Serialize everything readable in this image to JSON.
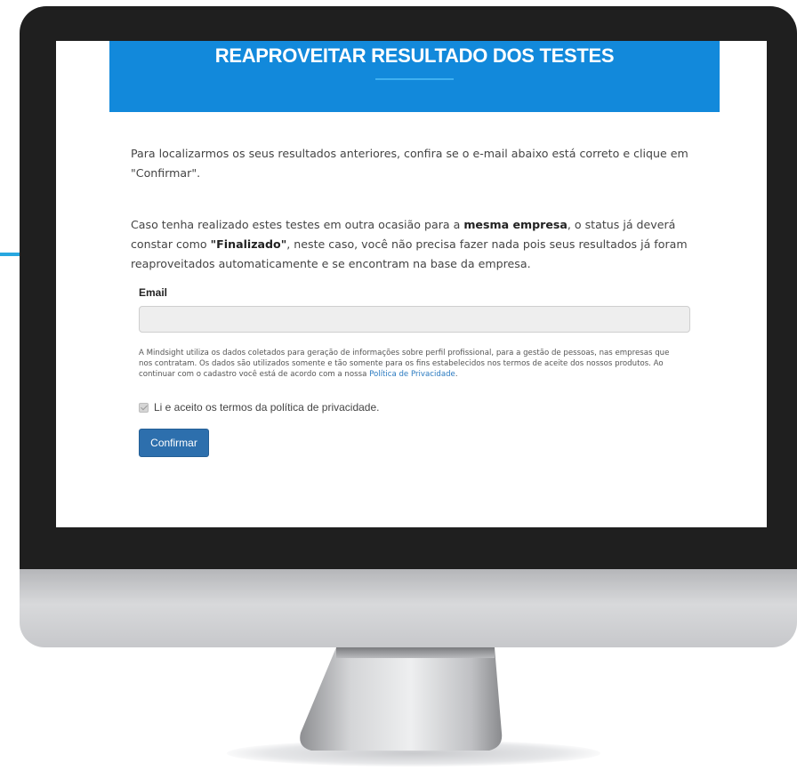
{
  "hero": {
    "title": "REAPROVEITAR RESULTADO DOS TESTES"
  },
  "intro": {
    "text": "Para localizarmos os seus resultados anteriores, confira se o e-mail abaixo está correto e clique em \"Confirmar\"."
  },
  "notice": {
    "part1": "Caso tenha realizado estes testes em outra ocasião para a ",
    "bold1": "mesma empresa",
    "part2": ", o status já deverá constar como ",
    "bold2": "\"Finalizado\"",
    "part3": ", neste caso, você não precisa fazer nada pois seus resultados já foram reaproveitados automaticamente e se encontram na base da empresa."
  },
  "form": {
    "email_label": "Email",
    "email_value": "",
    "email_placeholder": ""
  },
  "legal": {
    "text": "A Mindsight utiliza os dados coletados para geração de informações sobre perfil profissional, para a gestão de pessoas, nas empresas que nos contratam. Os dados são utilizados somente e tão somente para os fins estabelecidos nos termos de aceite dos nossos produtos. Ao continuar com o cadastro você está de acordo com a nossa ",
    "link_text": "Política de Privacidade",
    "suffix": "."
  },
  "consent": {
    "checked": true,
    "label": "Li e aceito os termos da política de privacidade."
  },
  "actions": {
    "confirm_label": "Confirmar"
  },
  "colors": {
    "hero_bg": "#1289db",
    "button_bg": "#2d6fad",
    "link": "#2a7ac0",
    "bezel": "#1f1f1f"
  }
}
